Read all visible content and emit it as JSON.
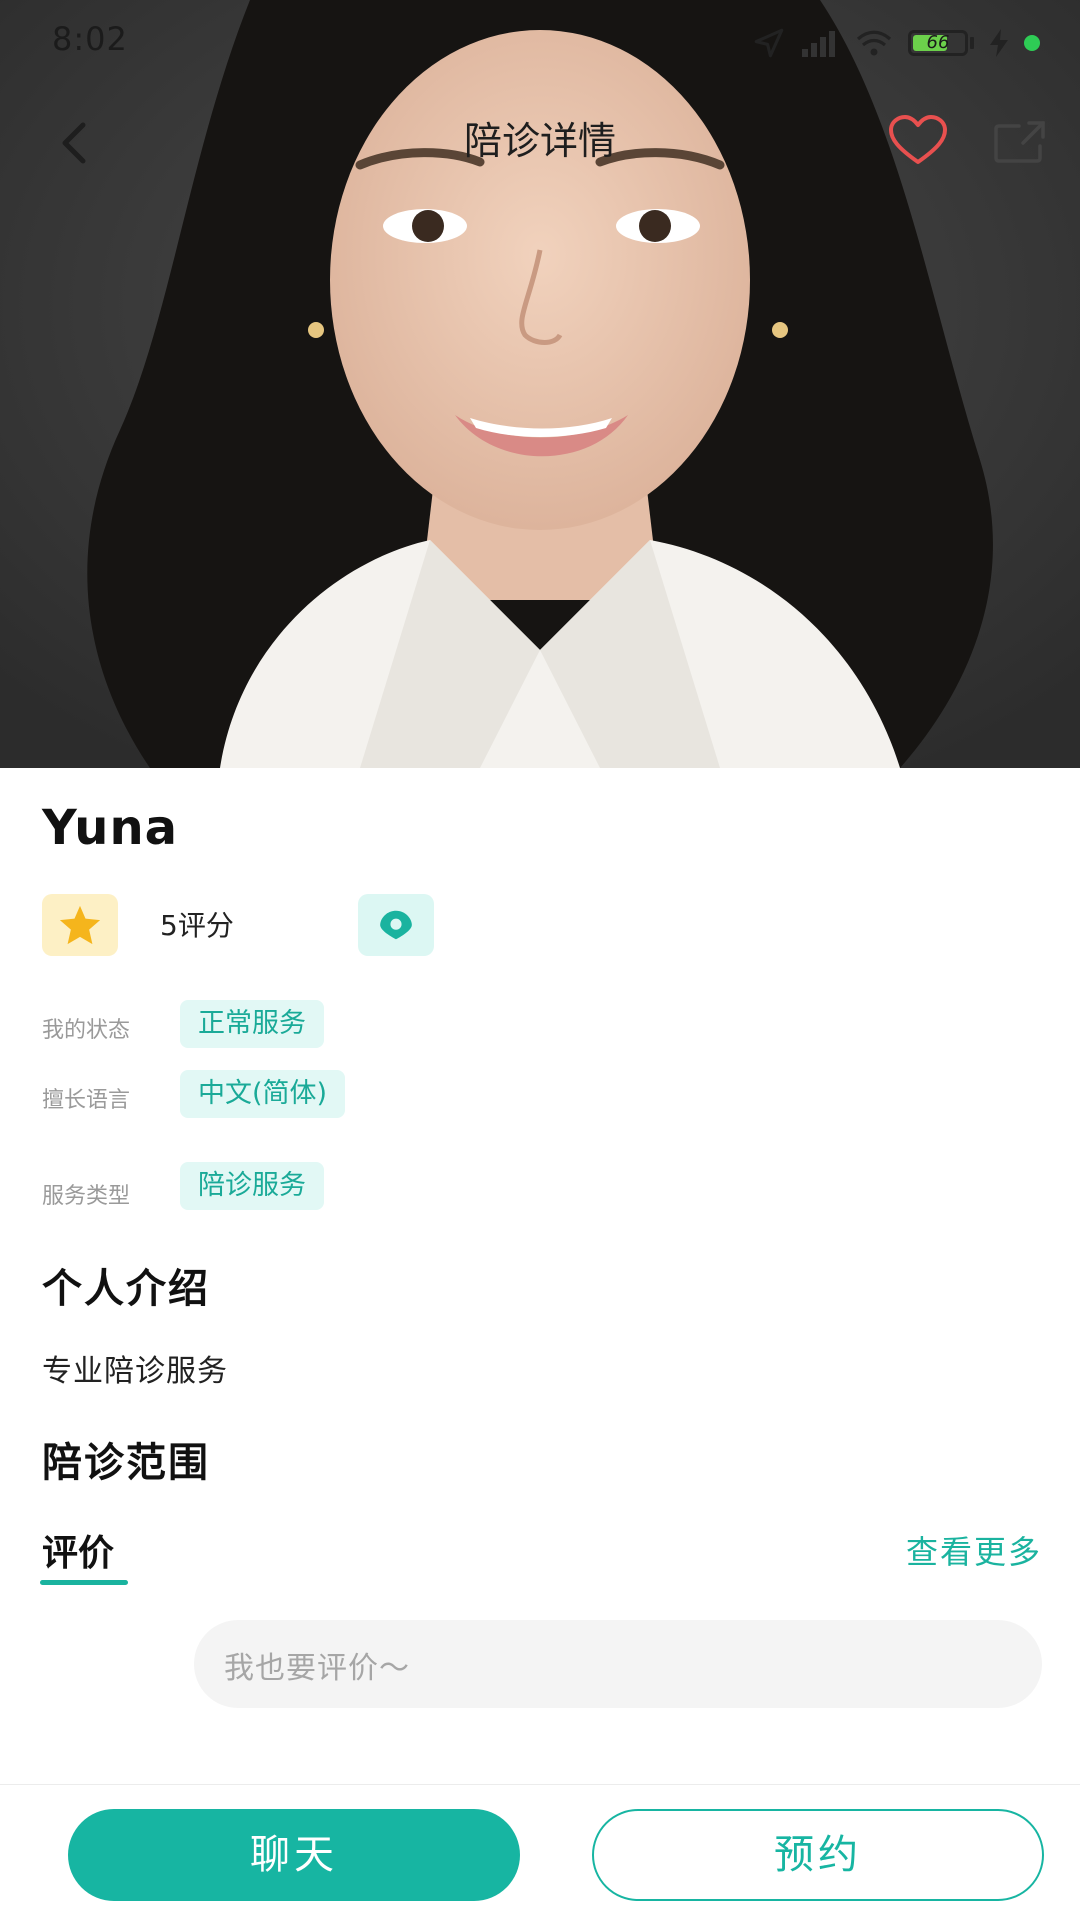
{
  "status_bar": {
    "time": "8:02",
    "battery_level": "66",
    "battery_fraction": 0.66,
    "icons": [
      "location-arrow-icon",
      "signal-icon",
      "wifi-icon",
      "battery-icon",
      "charging-icon",
      "notification-dot-icon"
    ]
  },
  "nav": {
    "title": "陪诊详情",
    "back_icon": "chevron-left-icon",
    "favorite_icon": "heart-outline-icon",
    "share_icon": "share-icon"
  },
  "profile": {
    "name": "Yuna",
    "rating_label": "5评分",
    "rating_icon": "star-icon",
    "location_icon": "location-pin-icon"
  },
  "info": {
    "status_label": "我的状态",
    "status_value": "正常服务",
    "language_label": "擅长语言",
    "language_value": "中文(简体)",
    "service_type_label": "服务类型",
    "service_type_value": "陪诊服务"
  },
  "intro": {
    "title": "个人介绍",
    "text": "专业陪诊服务"
  },
  "scope": {
    "title": "陪诊范围"
  },
  "reviews": {
    "title": "评价",
    "see_more": "查看更多",
    "input_placeholder": "我也要评价～"
  },
  "actions": {
    "chat_label": "聊天",
    "book_label": "预约"
  },
  "colors": {
    "accent": "#17b5a2",
    "tag_bg": "#e2f8f5",
    "star": "#f5b51c",
    "star_bg": "#fdf0c5",
    "heart": "#e8504f"
  }
}
